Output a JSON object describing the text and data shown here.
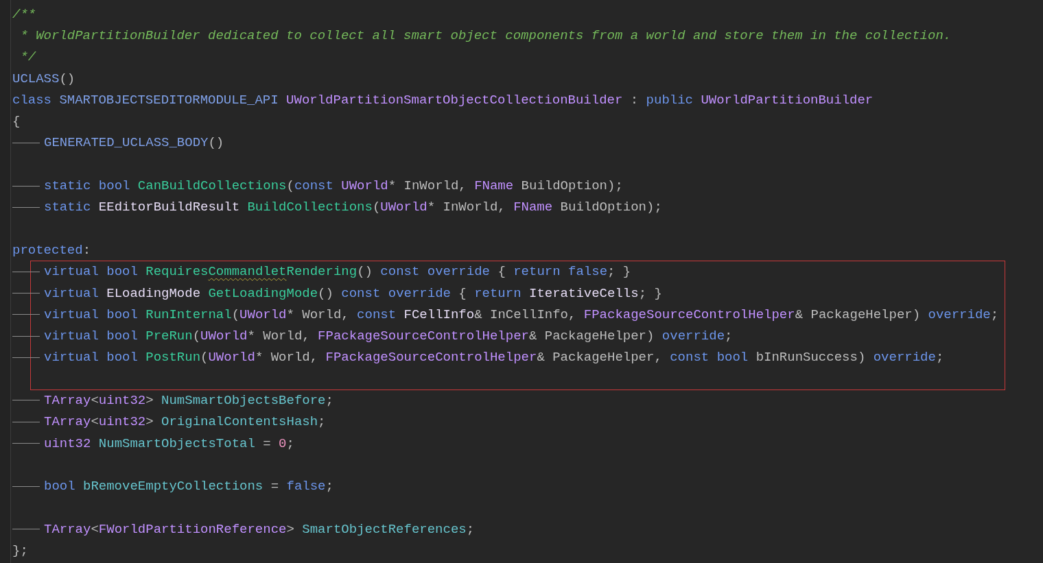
{
  "blocks": [
    {
      "kind": "plain",
      "lines": [
        {
          "tab": false,
          "tokens": [
            {
              "kind": "comment",
              "text": "/**"
            }
          ]
        },
        {
          "tab": false,
          "tokens": [
            {
              "kind": "comment",
              "text": " * WorldPartitionBuilder dedicated to collect all smart object components from a world and store them in the collection."
            }
          ]
        },
        {
          "tab": false,
          "tokens": [
            {
              "kind": "comment",
              "text": " */"
            }
          ]
        },
        {
          "tab": false,
          "tokens": [
            {
              "kind": "macro",
              "text": "UCLASS"
            },
            {
              "kind": "plain",
              "text": "()"
            }
          ]
        },
        {
          "tab": false,
          "tokens": [
            {
              "kind": "keyword",
              "text": "class"
            },
            {
              "kind": "macro",
              "text": " SMARTOBJECTSEDITORMODULE_API"
            },
            {
              "kind": "type",
              "text": " UWorldPartitionSmartObjectCollectionBuilder"
            },
            {
              "kind": "plain",
              "text": " :"
            },
            {
              "kind": "keyword",
              "text": " public"
            },
            {
              "kind": "type",
              "text": " UWorldPartitionBuilder"
            }
          ]
        },
        {
          "tab": false,
          "tokens": [
            {
              "kind": "plain",
              "text": "{"
            }
          ]
        },
        {
          "tab": true,
          "tokens": [
            {
              "kind": "macro",
              "text": "GENERATED_UCLASS_BODY"
            },
            {
              "kind": "plain",
              "text": "()"
            }
          ]
        },
        {
          "tab": false
        },
        {
          "tab": true,
          "tokens": [
            {
              "kind": "keyword",
              "text": "static"
            },
            {
              "kind": "keyword",
              "text": " bool"
            },
            {
              "kind": "func",
              "text": " CanBuildCollections"
            },
            {
              "kind": "plain",
              "text": "("
            },
            {
              "kind": "keyword",
              "text": "const"
            },
            {
              "kind": "type",
              "text": " UWorld"
            },
            {
              "kind": "plain",
              "text": "* InWorld,"
            },
            {
              "kind": "type",
              "text": " FName"
            },
            {
              "kind": "plain",
              "text": " BuildOption);"
            }
          ]
        },
        {
          "tab": true,
          "tokens": [
            {
              "kind": "keyword",
              "text": "static"
            },
            {
              "kind": "struct",
              "text": " EEditorBuildResult"
            },
            {
              "kind": "func",
              "text": " BuildCollections"
            },
            {
              "kind": "plain",
              "text": "("
            },
            {
              "kind": "type",
              "text": "UWorld"
            },
            {
              "kind": "plain",
              "text": "* InWorld,"
            },
            {
              "kind": "type",
              "text": " FName"
            },
            {
              "kind": "plain",
              "text": " BuildOption);"
            }
          ]
        },
        {
          "tab": false
        },
        {
          "tab": false,
          "tokens": [
            {
              "kind": "keyword",
              "text": "protected"
            },
            {
              "kind": "plain",
              "text": ":"
            }
          ]
        }
      ]
    },
    {
      "kind": "boxed",
      "lines": [
        {
          "tab": true,
          "tokens": [
            {
              "kind": "keyword",
              "text": "virtual"
            },
            {
              "kind": "keyword",
              "text": " bool"
            },
            {
              "kind": "func",
              "text": " Requires"
            },
            {
              "kind": "func",
              "text": "Commandlet",
              "typo": true
            },
            {
              "kind": "func",
              "text": "Rendering"
            },
            {
              "kind": "plain",
              "text": "()"
            },
            {
              "kind": "keyword",
              "text": " const"
            },
            {
              "kind": "keyword",
              "text": " override"
            },
            {
              "kind": "plain",
              "text": " {"
            },
            {
              "kind": "keyword",
              "text": " return"
            },
            {
              "kind": "keyword",
              "text": " false"
            },
            {
              "kind": "plain",
              "text": "; }"
            }
          ]
        },
        {
          "tab": true,
          "tokens": [
            {
              "kind": "keyword",
              "text": "virtual"
            },
            {
              "kind": "struct",
              "text": " ELoadingMode"
            },
            {
              "kind": "func",
              "text": " GetLoadingMode"
            },
            {
              "kind": "plain",
              "text": "()"
            },
            {
              "kind": "keyword",
              "text": " const"
            },
            {
              "kind": "keyword",
              "text": " override"
            },
            {
              "kind": "plain",
              "text": " {"
            },
            {
              "kind": "keyword",
              "text": " return"
            },
            {
              "kind": "struct",
              "text": " IterativeCells"
            },
            {
              "kind": "plain",
              "text": "; }"
            }
          ]
        },
        {
          "tab": true,
          "tokens": [
            {
              "kind": "keyword",
              "text": "virtual"
            },
            {
              "kind": "keyword",
              "text": " bool"
            },
            {
              "kind": "func",
              "text": " RunInternal"
            },
            {
              "kind": "plain",
              "text": "("
            },
            {
              "kind": "type",
              "text": "UWorld"
            },
            {
              "kind": "plain",
              "text": "* World,"
            },
            {
              "kind": "keyword",
              "text": " const"
            },
            {
              "kind": "struct",
              "text": " FCellInfo"
            },
            {
              "kind": "plain",
              "text": "& InCellInfo,"
            },
            {
              "kind": "type",
              "text": " FPackageSourceControlHelper"
            },
            {
              "kind": "plain",
              "text": "& PackageHelper)"
            },
            {
              "kind": "keyword",
              "text": " override"
            },
            {
              "kind": "plain",
              "text": ";"
            }
          ]
        },
        {
          "tab": true,
          "tokens": [
            {
              "kind": "keyword",
              "text": "virtual"
            },
            {
              "kind": "keyword",
              "text": " bool"
            },
            {
              "kind": "func",
              "text": " PreRun"
            },
            {
              "kind": "plain",
              "text": "("
            },
            {
              "kind": "type",
              "text": "UWorld"
            },
            {
              "kind": "plain",
              "text": "* World,"
            },
            {
              "kind": "type",
              "text": " FPackageSourceControlHelper"
            },
            {
              "kind": "plain",
              "text": "& PackageHelper)"
            },
            {
              "kind": "keyword",
              "text": " override"
            },
            {
              "kind": "plain",
              "text": ";"
            }
          ]
        },
        {
          "tab": true,
          "tokens": [
            {
              "kind": "keyword",
              "text": "virtual"
            },
            {
              "kind": "keyword",
              "text": " bool"
            },
            {
              "kind": "func",
              "text": " PostRun"
            },
            {
              "kind": "plain",
              "text": "("
            },
            {
              "kind": "type",
              "text": "UWorld"
            },
            {
              "kind": "plain",
              "text": "* World,"
            },
            {
              "kind": "type",
              "text": " FPackageSourceControlHelper"
            },
            {
              "kind": "plain",
              "text": "& PackageHelper,"
            },
            {
              "kind": "keyword",
              "text": " const"
            },
            {
              "kind": "keyword",
              "text": " bool"
            },
            {
              "kind": "plain",
              "text": " bInRunSuccess)"
            },
            {
              "kind": "keyword",
              "text": " override"
            },
            {
              "kind": "plain",
              "text": ";"
            }
          ]
        },
        {
          "tab": false
        }
      ]
    },
    {
      "kind": "plain",
      "lines": [
        {
          "tab": true,
          "tokens": [
            {
              "kind": "type",
              "text": "TArray"
            },
            {
              "kind": "plain",
              "text": "<"
            },
            {
              "kind": "type",
              "text": "uint32"
            },
            {
              "kind": "plain",
              "text": ">"
            },
            {
              "kind": "field",
              "text": " NumSmartObjectsBefore"
            },
            {
              "kind": "plain",
              "text": ";"
            }
          ]
        },
        {
          "tab": true,
          "tokens": [
            {
              "kind": "type",
              "text": "TArray"
            },
            {
              "kind": "plain",
              "text": "<"
            },
            {
              "kind": "type",
              "text": "uint32"
            },
            {
              "kind": "plain",
              "text": ">"
            },
            {
              "kind": "field",
              "text": " OriginalContentsHash"
            },
            {
              "kind": "plain",
              "text": ";"
            }
          ]
        },
        {
          "tab": true,
          "tokens": [
            {
              "kind": "type",
              "text": "uint32"
            },
            {
              "kind": "field",
              "text": " NumSmartObjectsTotal"
            },
            {
              "kind": "plain",
              "text": " ="
            },
            {
              "kind": "number",
              "text": " 0"
            },
            {
              "kind": "plain",
              "text": ";"
            }
          ]
        },
        {
          "tab": false
        },
        {
          "tab": true,
          "tokens": [
            {
              "kind": "keyword",
              "text": "bool"
            },
            {
              "kind": "field",
              "text": " bRemoveEmptyCollections"
            },
            {
              "kind": "plain",
              "text": " ="
            },
            {
              "kind": "keyword",
              "text": " false"
            },
            {
              "kind": "plain",
              "text": ";"
            }
          ]
        },
        {
          "tab": false
        },
        {
          "tab": true,
          "tokens": [
            {
              "kind": "type",
              "text": "TArray"
            },
            {
              "kind": "plain",
              "text": "<"
            },
            {
              "kind": "type",
              "text": "FWorldPartitionReference"
            },
            {
              "kind": "plain",
              "text": ">"
            },
            {
              "kind": "field",
              "text": " SmartObjectReferences"
            },
            {
              "kind": "plain",
              "text": ";"
            }
          ]
        },
        {
          "tab": false,
          "tokens": [
            {
              "kind": "plain",
              "text": "};"
            }
          ]
        }
      ]
    }
  ]
}
